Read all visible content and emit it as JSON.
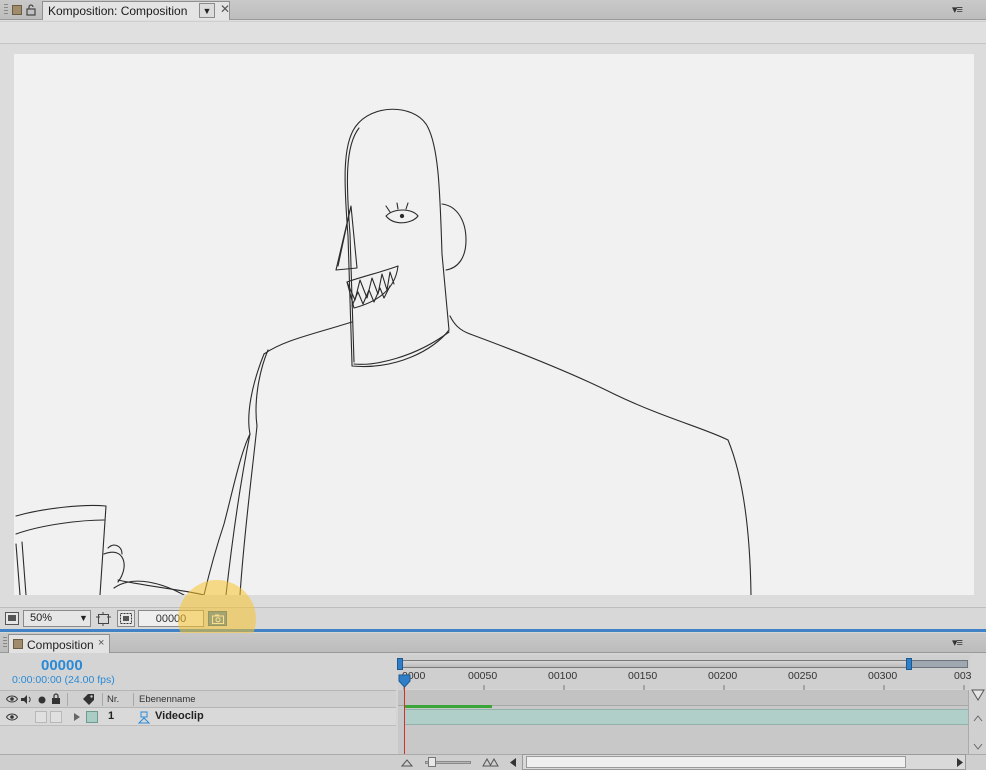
{
  "comp_panel": {
    "tab_label": "Komposition: Composition",
    "tab_dropdown_icon": "triangle-down-icon",
    "close_glyph": "✕",
    "menu_glyph": "▾≡",
    "lock_icon": "lock-icon"
  },
  "viewer_toolbar": {
    "zoom": "50%",
    "frame": "00000",
    "snapshot_icon": "camera-icon"
  },
  "timeline": {
    "tab_label": "Composition",
    "close_glyph": "×",
    "menu_glyph": "▾≡",
    "timecode": "00000",
    "fps_text": "0:00:00:00 (24.00 fps)",
    "columns": {
      "nr": "Nr.",
      "name": "Ebenenname"
    },
    "ruler_ticks": [
      "0000",
      "00050",
      "00100",
      "00150",
      "00200",
      "00250",
      "00300",
      "003"
    ],
    "layers": [
      {
        "nr": "1",
        "name": "Videoclip",
        "label_color": "#a9cdc5"
      }
    ]
  },
  "colors": {
    "accent": "#2a8ad6",
    "playhead": "#d23030",
    "cache": "#3aa63a",
    "highlight": "#f8c42e"
  }
}
